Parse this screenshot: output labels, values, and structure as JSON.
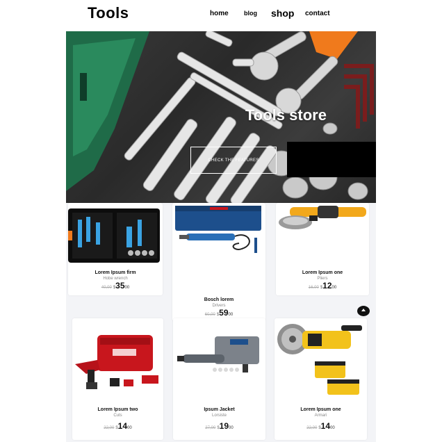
{
  "header": {
    "brand": "Tools",
    "nav": [
      "home",
      "blog",
      "shop",
      "contact"
    ]
  },
  "hero": {
    "title": "Tools store",
    "button_label": "CHECK THE FEATURES"
  },
  "products": [
    {
      "name": "Lorem Ipsum firm",
      "category": "Hobe wrench",
      "old_price": "40,00",
      "currency": "$",
      "price": "35",
      "cents": "00",
      "image": "toolkit-case"
    },
    {
      "name": "Bosch lorem",
      "category": "Drivers",
      "old_price": "60,00",
      "currency": "$",
      "price": "59",
      "cents": "00",
      "image": "cordless-screwdriver"
    },
    {
      "name": "Lorem Ipsum one",
      "category": "Pliers",
      "old_price": "16,00",
      "currency": "$",
      "price": "12",
      "cents": "00",
      "image": "angle-grinder"
    },
    {
      "name": "Lorem Ipsum two",
      "category": "Cuts",
      "old_price": "22,00",
      "currency": "$",
      "price": "14",
      "cents": "00",
      "image": "drill-kit"
    },
    {
      "name": "Ipsum Jacket",
      "category": "Lorsiste",
      "old_price": "27,00",
      "currency": "$",
      "price": "19",
      "cents": "00",
      "image": "rotary-tool-kit"
    },
    {
      "name": "Lorem Ipsum one",
      "category": "Armari",
      "old_price": "22,00",
      "currency": "$",
      "price": "14",
      "cents": "00",
      "image": "cut-off-saw"
    }
  ],
  "colors": {
    "accent": "#000000",
    "hero_dark": "#2e2e2e",
    "products_bg": "#f3f4f7",
    "tool_green": "#1f6b48",
    "tool_orange": "#f07a1c",
    "dewalt_yellow": "#f2c21b",
    "milwaukee_red": "#c8161d",
    "bosch_blue": "#1d4f8c"
  }
}
